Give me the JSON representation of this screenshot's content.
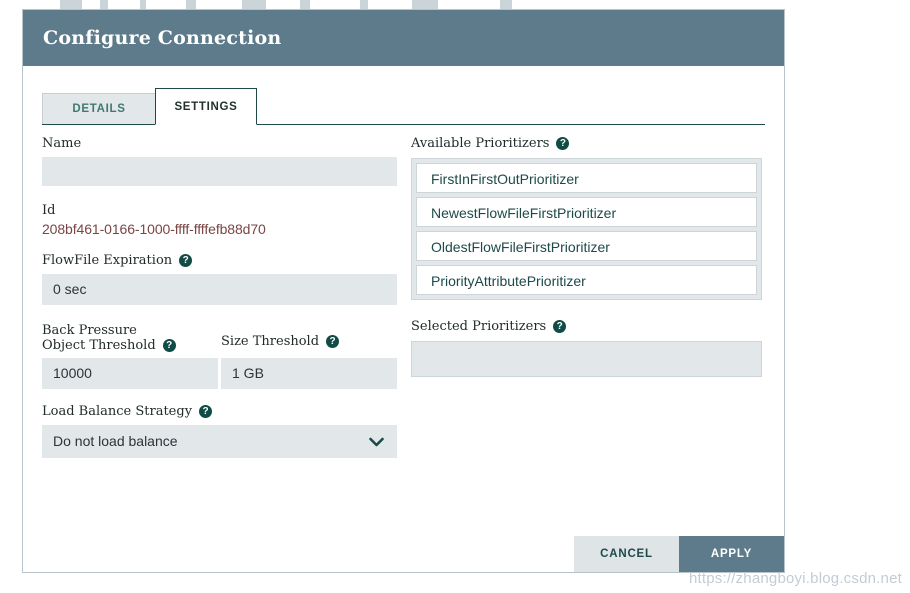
{
  "dialog": {
    "title": "Configure Connection",
    "tabs": [
      {
        "label": "DETAILS",
        "active": false
      },
      {
        "label": "SETTINGS",
        "active": true
      }
    ]
  },
  "settings": {
    "name": {
      "label": "Name",
      "value": "",
      "placeholder": ""
    },
    "id": {
      "label": "Id",
      "value": "208bf461-0166-1000-ffff-ffffefb88d70"
    },
    "flowfile_expiration": {
      "label": "FlowFile Expiration",
      "value": "0 sec",
      "help_icon": "help-circle-icon"
    },
    "back_pressure": {
      "group_label": "Back Pressure",
      "object_threshold": {
        "label": "Object Threshold",
        "value": "10000",
        "help_icon": "help-circle-icon"
      },
      "size_threshold": {
        "label": "Size Threshold",
        "value": "1 GB",
        "help_icon": "help-circle-icon"
      }
    },
    "load_balance_strategy": {
      "label": "Load Balance Strategy",
      "value": "Do not load balance",
      "help_icon": "help-circle-icon",
      "chevron_icon": "chevron-down-icon"
    },
    "available_prioritizers": {
      "label": "Available Prioritizers",
      "help_icon": "help-circle-icon",
      "items": [
        "FirstInFirstOutPrioritizer",
        "NewestFlowFileFirstPrioritizer",
        "OldestFlowFileFirstPrioritizer",
        "PriorityAttributePrioritizer"
      ]
    },
    "selected_prioritizers": {
      "label": "Selected Prioritizers",
      "help_icon": "help-circle-icon",
      "items": []
    }
  },
  "footer": {
    "cancel_label": "CANCEL",
    "apply_label": "APPLY"
  },
  "watermark": "https://zhangboyi.blog.csdn.net",
  "colors": {
    "header_bar": "#5d7b8a",
    "accent_teal": "#1d4a48",
    "input_bg": "#e2e7ea",
    "id_text": "#7b4545",
    "apply_bg": "#5d7b8a",
    "cancel_bg": "#dfe4e7"
  },
  "help_glyph": "?"
}
